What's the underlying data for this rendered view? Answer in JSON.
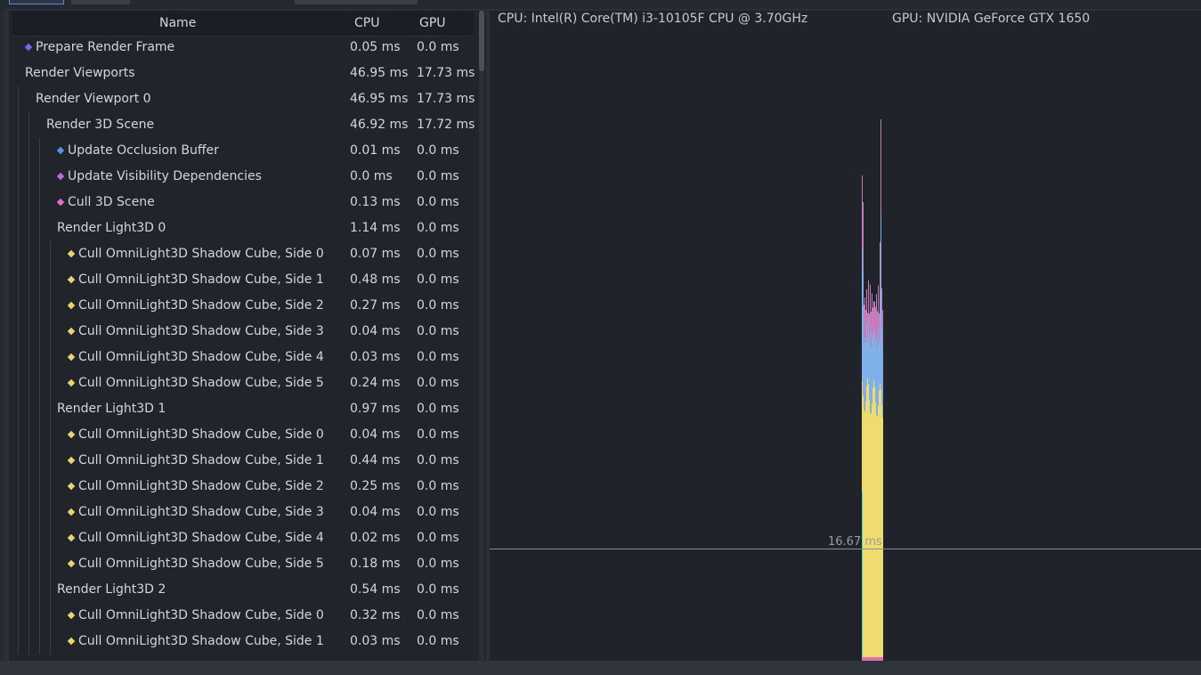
{
  "columns": {
    "name": "Name",
    "cpu": "CPU",
    "gpu": "GPU"
  },
  "rows": [
    {
      "label": "Prepare Render Frame",
      "cpu": "0.05 ms",
      "gpu": "0.0 ms",
      "depth": 0,
      "dot": "#7a66e6"
    },
    {
      "label": "Render Viewports",
      "cpu": "46.95 ms",
      "gpu": "17.73 ms",
      "depth": 0,
      "dot": ""
    },
    {
      "label": "Render Viewport 0",
      "cpu": "46.95 ms",
      "gpu": "17.73 ms",
      "depth": 1,
      "dot": ""
    },
    {
      "label": "Render 3D Scene",
      "cpu": "46.92 ms",
      "gpu": "17.72 ms",
      "depth": 2,
      "dot": ""
    },
    {
      "label": "Update Occlusion Buffer",
      "cpu": "0.01 ms",
      "gpu": "0.0 ms",
      "depth": 3,
      "dot": "#5b8ee6"
    },
    {
      "label": "Update Visibility Dependencies",
      "cpu": "0.0 ms",
      "gpu": "0.0 ms",
      "depth": 3,
      "dot": "#b66ee6"
    },
    {
      "label": "Cull 3D Scene",
      "cpu": "0.13 ms",
      "gpu": "0.0 ms",
      "depth": 3,
      "dot": "#e66ec4"
    },
    {
      "label": "Render Light3D 0",
      "cpu": "1.14 ms",
      "gpu": "0.0 ms",
      "depth": 3,
      "dot": ""
    },
    {
      "label": "Cull OmniLight3D Shadow Cube, Side 0",
      "cpu": "0.07 ms",
      "gpu": "0.0 ms",
      "depth": 4,
      "dot": "#e8d66a"
    },
    {
      "label": "Cull OmniLight3D Shadow Cube, Side 1",
      "cpu": "0.48 ms",
      "gpu": "0.0 ms",
      "depth": 4,
      "dot": "#e8d66a"
    },
    {
      "label": "Cull OmniLight3D Shadow Cube, Side 2",
      "cpu": "0.27 ms",
      "gpu": "0.0 ms",
      "depth": 4,
      "dot": "#e8d66a"
    },
    {
      "label": "Cull OmniLight3D Shadow Cube, Side 3",
      "cpu": "0.04 ms",
      "gpu": "0.0 ms",
      "depth": 4,
      "dot": "#e8d66a"
    },
    {
      "label": "Cull OmniLight3D Shadow Cube, Side 4",
      "cpu": "0.03 ms",
      "gpu": "0.0 ms",
      "depth": 4,
      "dot": "#e8d66a"
    },
    {
      "label": "Cull OmniLight3D Shadow Cube, Side 5",
      "cpu": "0.24 ms",
      "gpu": "0.0 ms",
      "depth": 4,
      "dot": "#e8d66a"
    },
    {
      "label": "Render Light3D 1",
      "cpu": "0.97 ms",
      "gpu": "0.0 ms",
      "depth": 3,
      "dot": ""
    },
    {
      "label": "Cull OmniLight3D Shadow Cube, Side 0",
      "cpu": "0.04 ms",
      "gpu": "0.0 ms",
      "depth": 4,
      "dot": "#e8d66a"
    },
    {
      "label": "Cull OmniLight3D Shadow Cube, Side 1",
      "cpu": "0.44 ms",
      "gpu": "0.0 ms",
      "depth": 4,
      "dot": "#e8d66a"
    },
    {
      "label": "Cull OmniLight3D Shadow Cube, Side 2",
      "cpu": "0.25 ms",
      "gpu": "0.0 ms",
      "depth": 4,
      "dot": "#e8d66a"
    },
    {
      "label": "Cull OmniLight3D Shadow Cube, Side 3",
      "cpu": "0.04 ms",
      "gpu": "0.0 ms",
      "depth": 4,
      "dot": "#e8d66a"
    },
    {
      "label": "Cull OmniLight3D Shadow Cube, Side 4",
      "cpu": "0.02 ms",
      "gpu": "0.0 ms",
      "depth": 4,
      "dot": "#e8d66a"
    },
    {
      "label": "Cull OmniLight3D Shadow Cube, Side 5",
      "cpu": "0.18 ms",
      "gpu": "0.0 ms",
      "depth": 4,
      "dot": "#e8d66a"
    },
    {
      "label": "Render Light3D 2",
      "cpu": "0.54 ms",
      "gpu": "0.0 ms",
      "depth": 3,
      "dot": ""
    },
    {
      "label": "Cull OmniLight3D Shadow Cube, Side 0",
      "cpu": "0.32 ms",
      "gpu": "0.0 ms",
      "depth": 4,
      "dot": "#e8d66a"
    },
    {
      "label": "Cull OmniLight3D Shadow Cube, Side 1",
      "cpu": "0.03 ms",
      "gpu": "0.0 ms",
      "depth": 4,
      "dot": "#e8d66a"
    }
  ],
  "graph": {
    "cpu_info": "CPU: Intel(R) Core(TM) i3-10105F CPU @ 3.70GHz",
    "gpu_info": "GPU: NVIDIA GeForce GTX 1650",
    "frame_line_label": "16.67 ms"
  }
}
